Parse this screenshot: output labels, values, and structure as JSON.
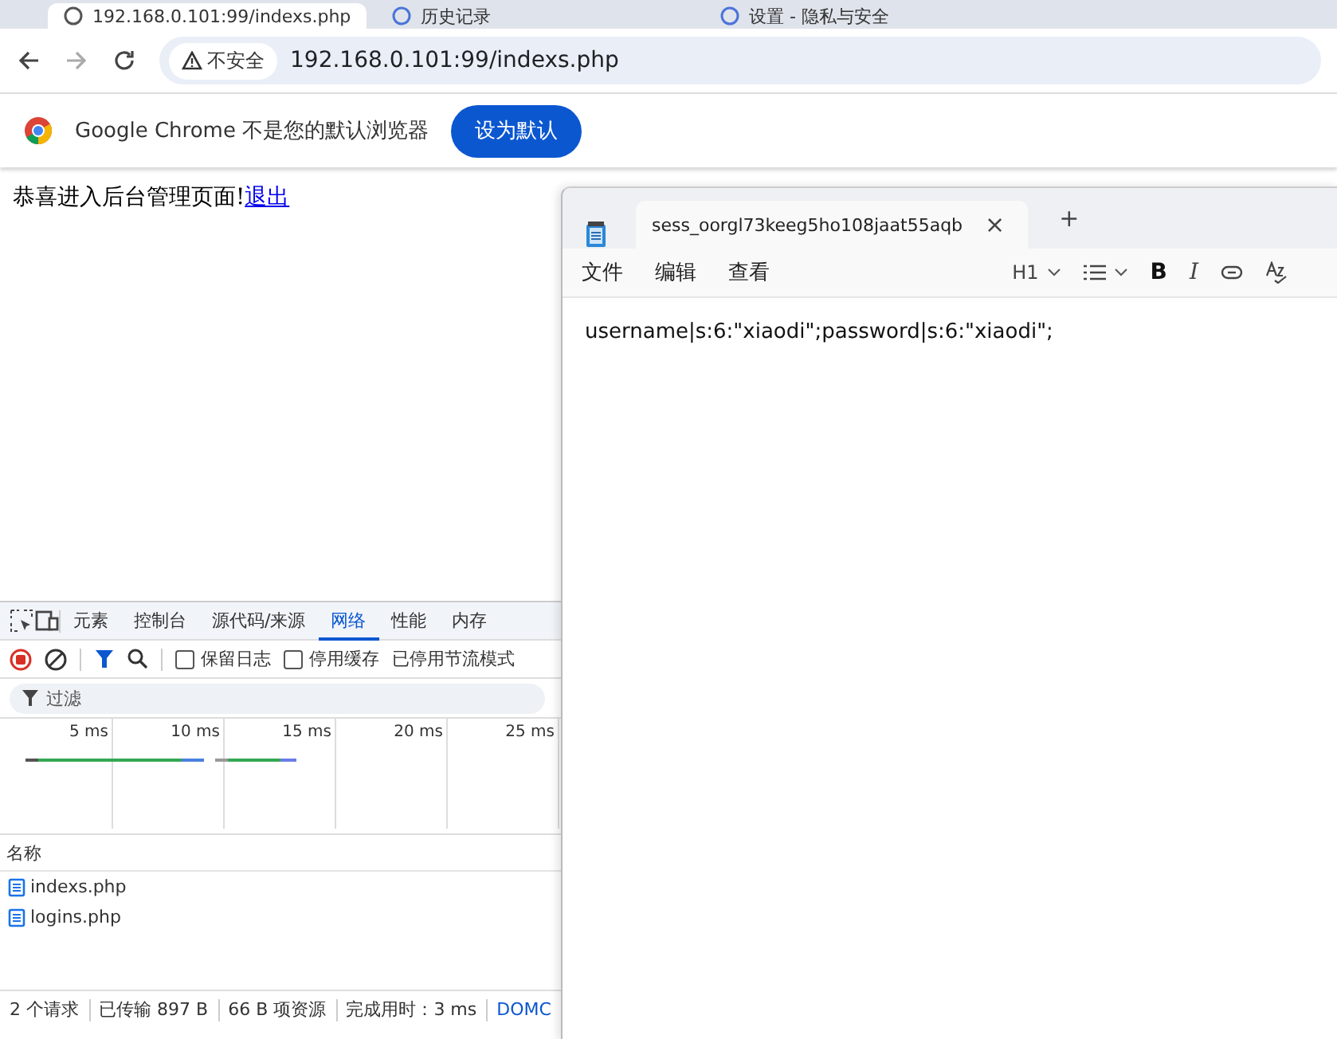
{
  "browser_tabs": [
    {
      "title": "192.168.0.101:99/indexs.php",
      "selected": true
    },
    {
      "title": "历史记录",
      "selected": false
    },
    {
      "title": "设置 - 隐私与安全",
      "selected": false
    }
  ],
  "address_bar": {
    "security_label": "不安全",
    "url": "192.168.0.101:99/indexs.php"
  },
  "info_bar": {
    "message": "Google Chrome 不是您的默认浏览器",
    "button": "设为默认"
  },
  "page": {
    "text": "恭喜进入后台管理页面!",
    "link": "退出"
  },
  "devtools": {
    "tabs": [
      {
        "label": "元素",
        "selected": false
      },
      {
        "label": "控制台",
        "selected": false
      },
      {
        "label": "源代码/来源",
        "selected": false
      },
      {
        "label": "网络",
        "selected": true
      },
      {
        "label": "性能",
        "selected": false
      },
      {
        "label": "内存",
        "selected": false
      }
    ],
    "options": [
      {
        "label": "保留日志",
        "checked": false
      },
      {
        "label": "停用缓存",
        "checked": false
      }
    ],
    "throttling": "已停用节流模式",
    "filter_placeholder": "过滤",
    "timeline_ticks": [
      "5 ms",
      "10 ms",
      "15 ms",
      "20 ms",
      "25 ms"
    ],
    "column": "名称",
    "requests": [
      "indexs.php",
      "logins.php"
    ],
    "status": [
      "2 个请求",
      "已传输 897 B",
      "66 B 项资源",
      "完成用时：3 ms",
      "DOMC"
    ]
  },
  "notepad": {
    "tab_title": "sess_oorgl73keeg5ho108jaat55aqb",
    "close": "×",
    "new_tab": "+",
    "menu": [
      "文件",
      "编辑",
      "查看"
    ],
    "heading": "H1",
    "bold": "B",
    "italic": "I",
    "content": "username|s:6:\"xiaodi\";password|s:6:\"xiaodi\";"
  }
}
